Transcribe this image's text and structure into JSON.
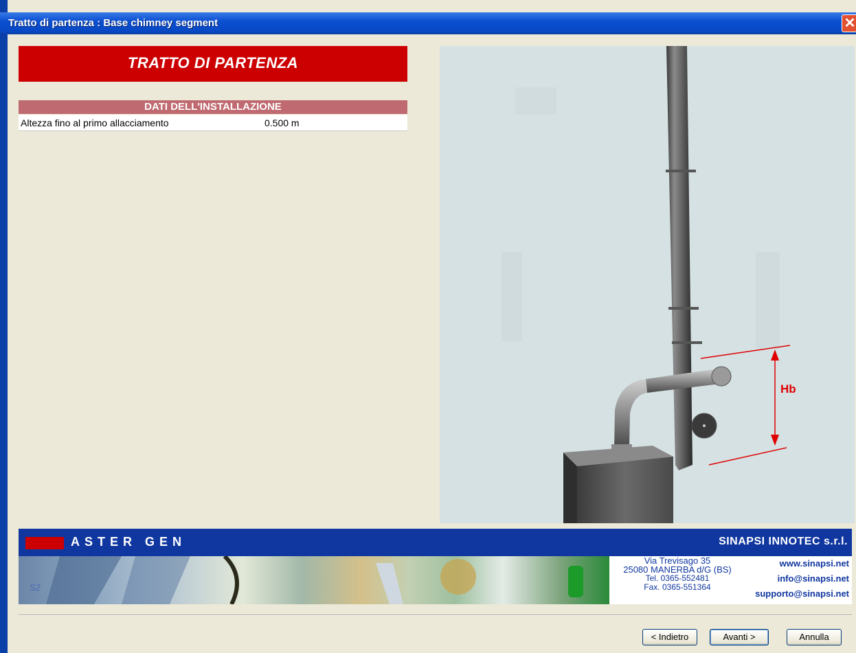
{
  "window": {
    "title": "Tratto di partenza : Base chimney segment",
    "close_glyph": "✕"
  },
  "banner": {
    "title": "TRATTO DI PARTENZA"
  },
  "section": {
    "header": "DATI DELL'INSTALLAZIONE",
    "rows": [
      {
        "label": "Altezza fino al primo allacciamento",
        "value": "0.500 m"
      }
    ]
  },
  "preview": {
    "dimension_label": "Hb"
  },
  "footer": {
    "brand_left": "ASTER GEN",
    "brand_right": "SINAPSI INNOTEC s.r.l.",
    "photo_tag": "S2",
    "address": [
      "Via Trevisago 35",
      "25080 MANERBA d/G (BS)",
      "Tel. 0365-552481",
      "Fax. 0365-551364"
    ],
    "web": [
      "www.sinapsi.net",
      "info@sinapsi.net",
      "supporto@sinapsi.net"
    ]
  },
  "buttons": {
    "back": "< Indietro",
    "next": "Avanti >",
    "cancel": "Annulla"
  },
  "colors": {
    "banner_red": "#cc0000",
    "section_header": "#bf6a70",
    "footer_blue": "#1037a0",
    "dimension_red": "#e00000"
  }
}
